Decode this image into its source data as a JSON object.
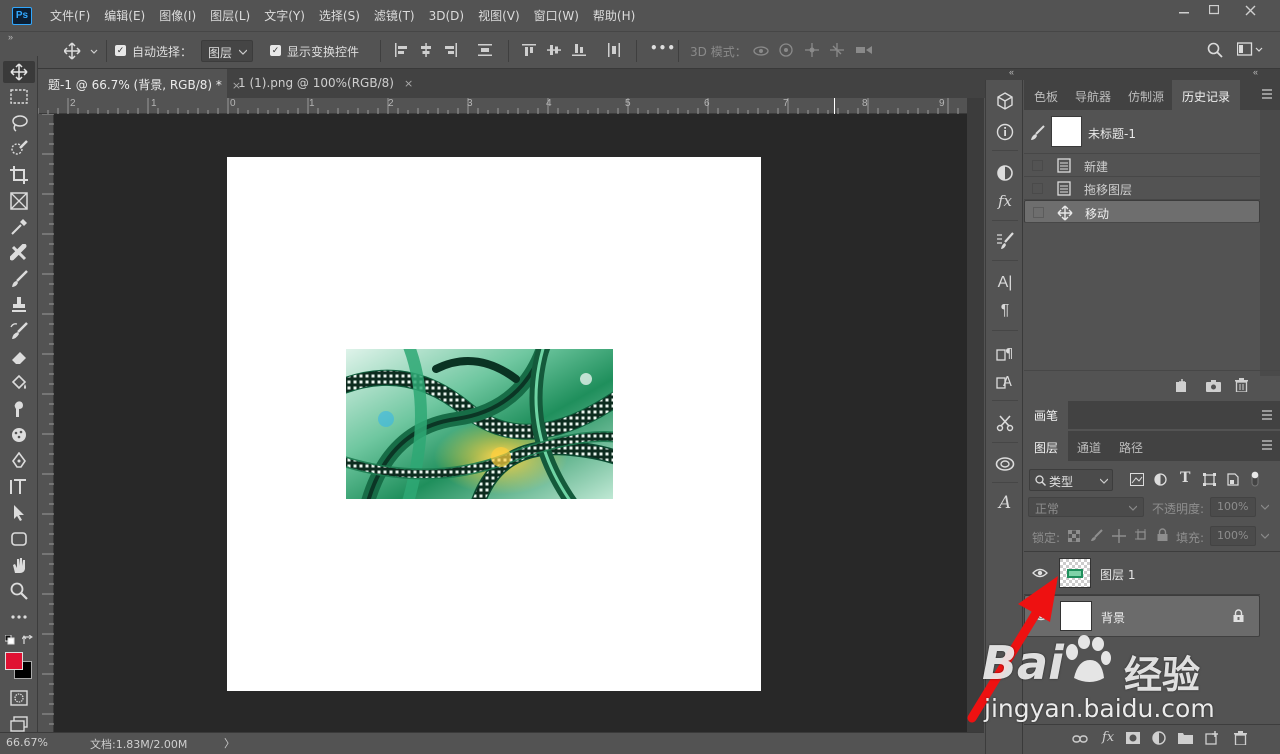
{
  "app": {
    "logo": "Ps"
  },
  "menubar": {
    "items": [
      "文件(F)",
      "编辑(E)",
      "图像(I)",
      "图层(L)",
      "文字(Y)",
      "选择(S)",
      "滤镜(T)",
      "3D(D)",
      "视图(V)",
      "窗口(W)",
      "帮助(H)"
    ]
  },
  "options": {
    "auto_select_label": "自动选择：",
    "auto_select_value": "图层",
    "show_transform_label": "显示变换控件",
    "more": "•••",
    "mode3d_label": "3D 模式："
  },
  "tabs": [
    {
      "label": "题-1 @ 66.7% (背景, RGB/8) *",
      "close": "×"
    },
    {
      "label": "1 (1).png @ 100%(RGB/8)",
      "close": "×"
    }
  ],
  "ruler": {
    "h_numbers": [
      "2",
      "1",
      "0",
      "1",
      "2",
      "3",
      "4",
      "5",
      "6",
      "7",
      "8",
      "9"
    ]
  },
  "status": {
    "zoom": "66.67%",
    "doc": "文档:1.83M/2.00M",
    "arrow": "〉"
  },
  "history_panel": {
    "tabs": [
      "色板",
      "导航器",
      "仿制源",
      "历史记录"
    ],
    "snapshot_label": "未标题-1",
    "items": [
      "新建",
      "拖移图层",
      "移动"
    ]
  },
  "brush_panel": {
    "tab": "画笔"
  },
  "layers_panel": {
    "tabs": [
      "图层",
      "通道",
      "路径"
    ],
    "filter_label": "类型",
    "blend_mode": "正常",
    "opacity_label": "不透明度:",
    "opacity_value": "100%",
    "lock_label": "锁定:",
    "fill_label": "填充:",
    "fill_value": "100%",
    "layers": [
      {
        "name": "图层 1",
        "visible": true,
        "locked": false
      },
      {
        "name": "背景",
        "visible": true,
        "locked": true
      }
    ]
  },
  "watermark": {
    "brand": "Bai",
    "brand_cn": "经验",
    "url": "jingyan.baidu.com"
  },
  "colors": {
    "foreground": "#e01233",
    "background": "#000000",
    "accent": "#31a8ff",
    "annotation_arrow": "#ee1111"
  }
}
